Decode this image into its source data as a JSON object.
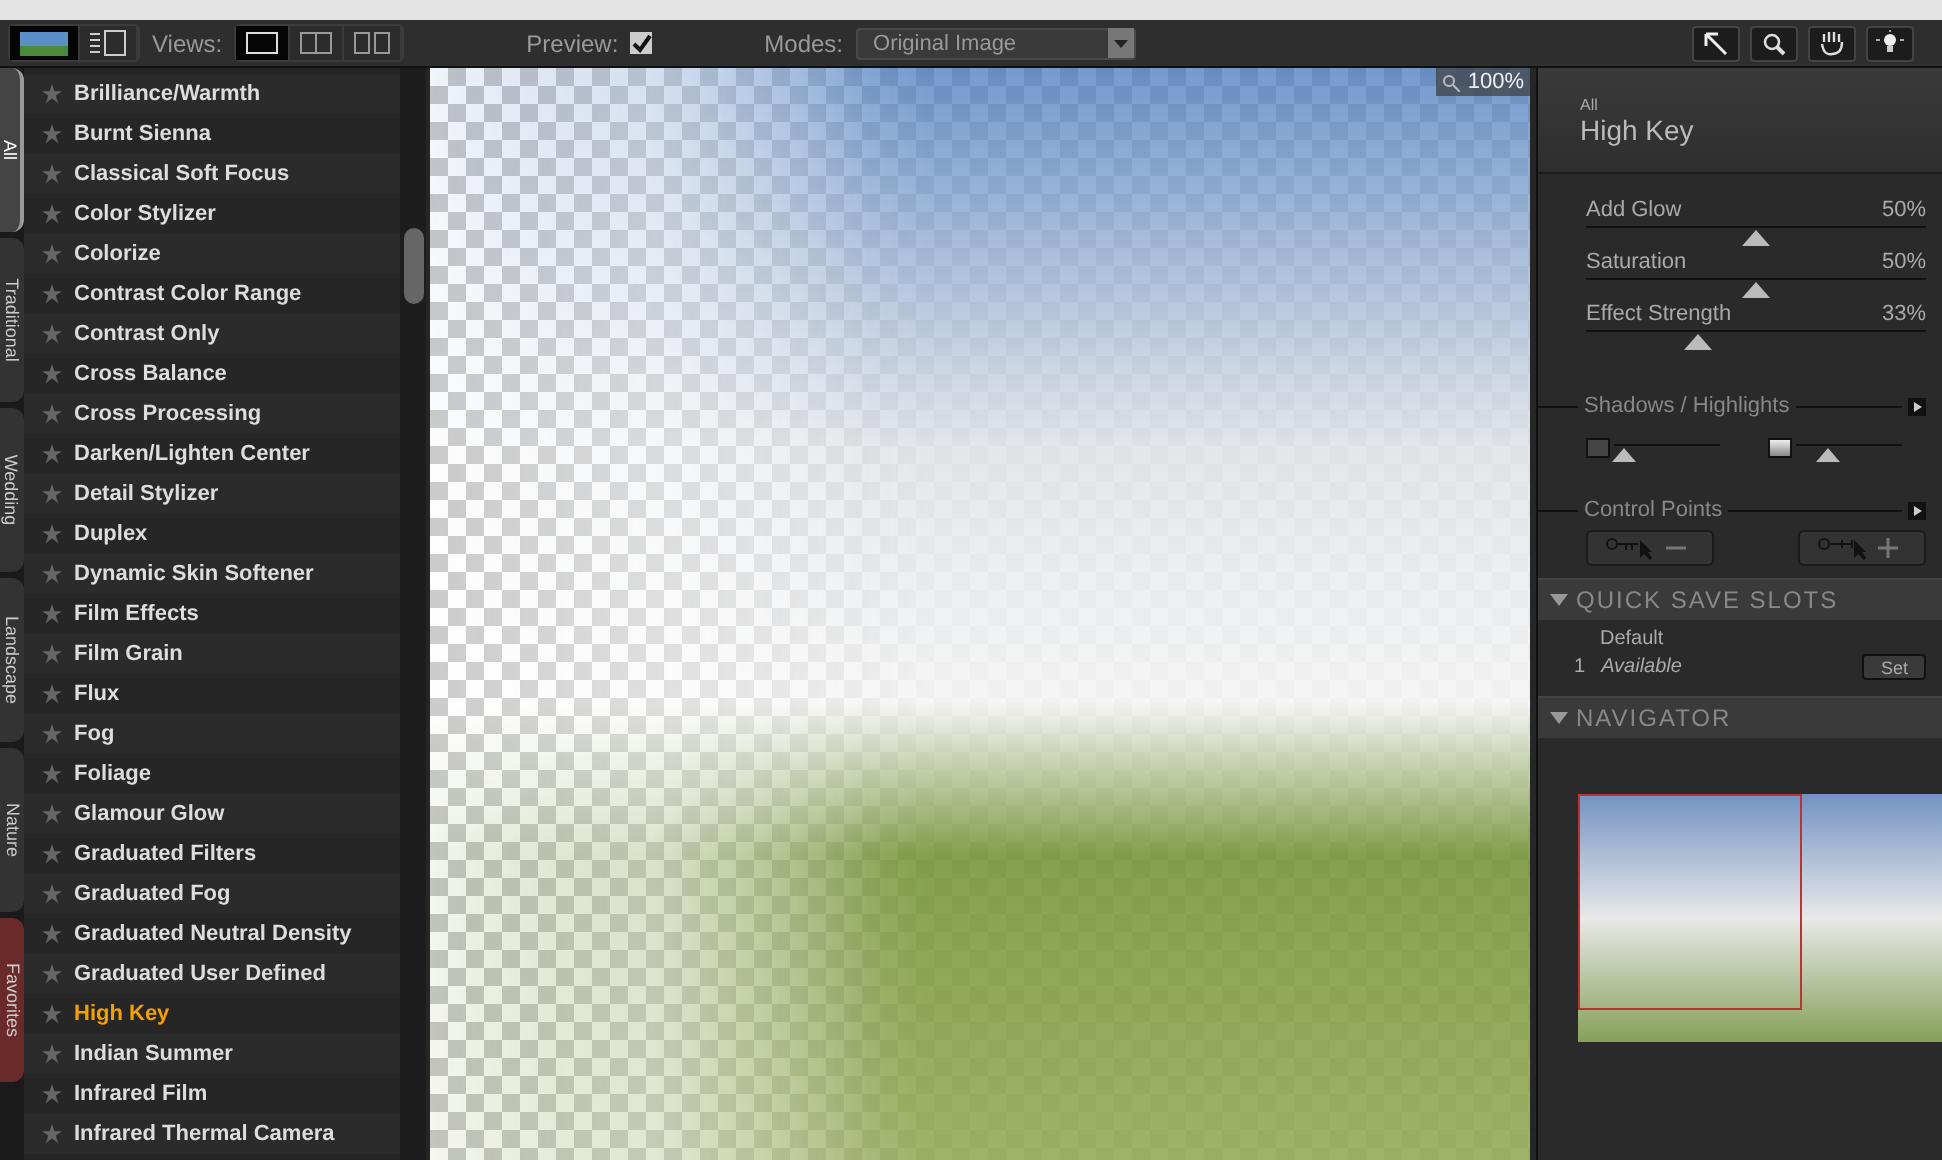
{
  "toolbar": {
    "panel_toggles": [
      {
        "kind": "image",
        "selected": true
      },
      {
        "kind": "list",
        "selected": false
      }
    ],
    "views_label": "Views:",
    "views": [
      {
        "kind": "single",
        "selected": true
      },
      {
        "kind": "split",
        "selected": false
      },
      {
        "kind": "side",
        "selected": false
      }
    ],
    "preview_label": "Preview:",
    "preview_checked": true,
    "modes_label": "Modes:",
    "mode_value": "Original Image",
    "tools": [
      {
        "kind": "arrow",
        "selected": false
      },
      {
        "kind": "zoom",
        "selected": false
      },
      {
        "kind": "hand",
        "selected": false
      },
      {
        "kind": "light",
        "selected": false
      }
    ]
  },
  "category_tabs": [
    {
      "label": "All",
      "selected": true
    },
    {
      "label": "Traditional",
      "selected": false
    },
    {
      "label": "Wedding",
      "selected": false
    },
    {
      "label": "Landscape",
      "selected": false
    },
    {
      "label": "Nature",
      "selected": false
    },
    {
      "label": "Favorites",
      "selected": false
    }
  ],
  "filters": [
    {
      "label": "Brilliance/Warmth",
      "selected": false
    },
    {
      "label": "Burnt Sienna",
      "selected": false
    },
    {
      "label": "Classical Soft Focus",
      "selected": false
    },
    {
      "label": "Color Stylizer",
      "selected": false
    },
    {
      "label": "Colorize",
      "selected": false
    },
    {
      "label": "Contrast Color Range",
      "selected": false
    },
    {
      "label": "Contrast Only",
      "selected": false
    },
    {
      "label": "Cross Balance",
      "selected": false
    },
    {
      "label": "Cross Processing",
      "selected": false
    },
    {
      "label": "Darken/Lighten Center",
      "selected": false
    },
    {
      "label": "Detail Stylizer",
      "selected": false
    },
    {
      "label": "Duplex",
      "selected": false
    },
    {
      "label": "Dynamic Skin Softener",
      "selected": false
    },
    {
      "label": "Film Effects",
      "selected": false
    },
    {
      "label": "Film Grain",
      "selected": false
    },
    {
      "label": "Flux",
      "selected": false
    },
    {
      "label": "Fog",
      "selected": false
    },
    {
      "label": "Foliage",
      "selected": false
    },
    {
      "label": "Glamour Glow",
      "selected": false
    },
    {
      "label": "Graduated Filters",
      "selected": false
    },
    {
      "label": "Graduated Fog",
      "selected": false
    },
    {
      "label": "Graduated Neutral Density",
      "selected": false
    },
    {
      "label": "Graduated User Defined",
      "selected": false
    },
    {
      "label": "High Key",
      "selected": true
    },
    {
      "label": "Indian Summer",
      "selected": false
    },
    {
      "label": "Infrared Film",
      "selected": false
    },
    {
      "label": "Infrared Thermal Camera",
      "selected": false
    }
  ],
  "canvas": {
    "zoom": "100%"
  },
  "panel": {
    "category": "All",
    "filter_name": "High Key",
    "sliders": [
      {
        "label": "Add Glow",
        "reading": "50%",
        "level": 0.5
      },
      {
        "label": "Saturation",
        "reading": "50%",
        "level": 0.5
      },
      {
        "label": "Effect Strength",
        "reading": "33%",
        "level": 0.33
      }
    ],
    "shadows_highlights": {
      "title": "Shadows / Highlights",
      "shadows": {
        "level": 0.1
      },
      "highlights": {
        "level": 0.3
      }
    },
    "control_points": {
      "title": "Control Points"
    }
  },
  "quick_save": {
    "title": "QUICK SAVE SLOTS",
    "default_label": "Default",
    "slots": [
      {
        "number": "1",
        "label": "Available",
        "button": "Set"
      }
    ]
  },
  "navigator": {
    "title": "NAVIGATOR"
  }
}
